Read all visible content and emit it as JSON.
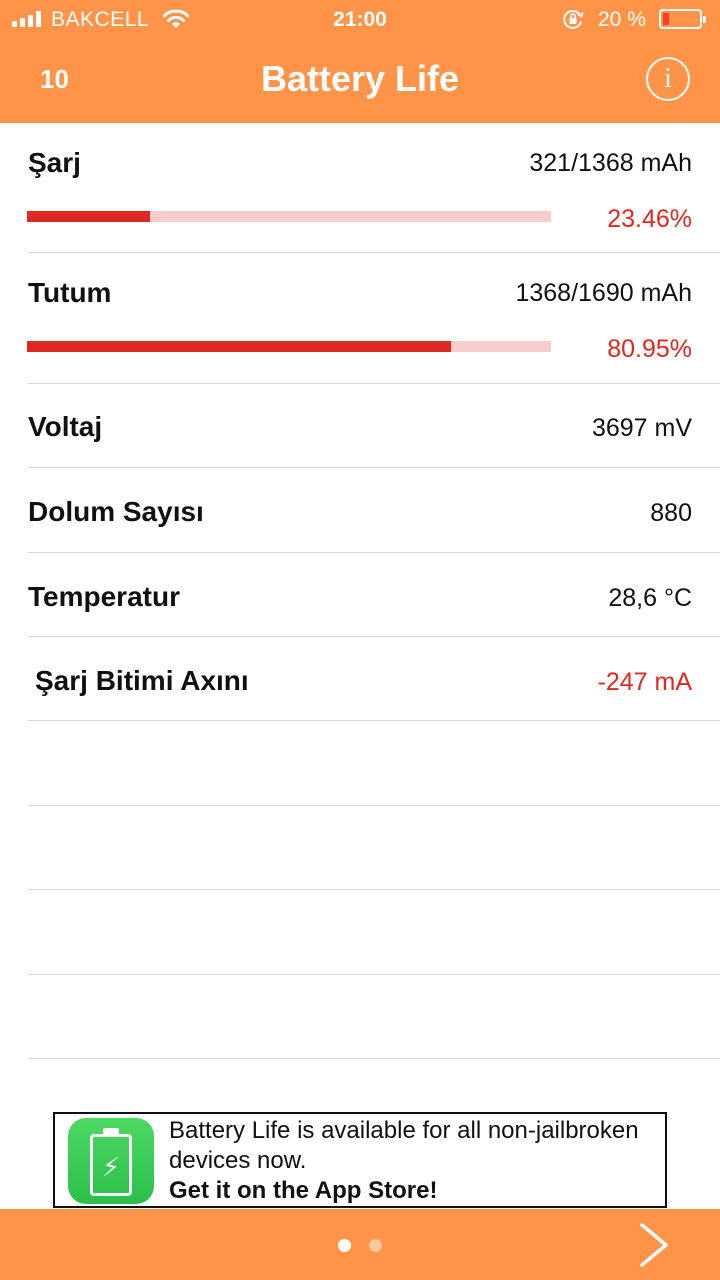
{
  "status_bar": {
    "carrier": "BAKCELL",
    "time": "21:00",
    "battery_percent": "20 %",
    "battery_level": 0.2,
    "icons": [
      "signal-icon",
      "wifi-icon",
      "orientation-lock-icon",
      "battery-icon"
    ]
  },
  "nav": {
    "count": "10",
    "title": "Battery Life",
    "info_icon": "info-icon",
    "info_glyph": "i"
  },
  "charge": {
    "label": "Şarj",
    "value": "321/1368 mAh",
    "percent_text": "23.46%",
    "percent": 23.46
  },
  "capacity": {
    "label": "Tutum",
    "value": "1368/1690 mAh",
    "percent_text": "80.95%",
    "percent": 80.95
  },
  "stats": [
    {
      "label": "Voltaj",
      "value": "3697 mV"
    },
    {
      "label": "Dolum Sayısı",
      "value": "880"
    },
    {
      "label": "Temperatur",
      "value": "28,6 °C"
    },
    {
      "label": "Şarj Bitimi Axını",
      "value": "-247 mA"
    }
  ],
  "ad": {
    "line1": "Battery Life is available for all non-jailbroken",
    "line2": "devices now.",
    "line3": "Get it on the App Store!",
    "icon": "battery-app-icon"
  },
  "pager": {
    "pages": 2,
    "current": 1
  },
  "colors": {
    "accent": "#ff9448",
    "bar_fill": "#dc2a22",
    "bar_track": "#f6cccc",
    "negative": "#e0281f",
    "ad_icon_green": "#4cd964"
  }
}
